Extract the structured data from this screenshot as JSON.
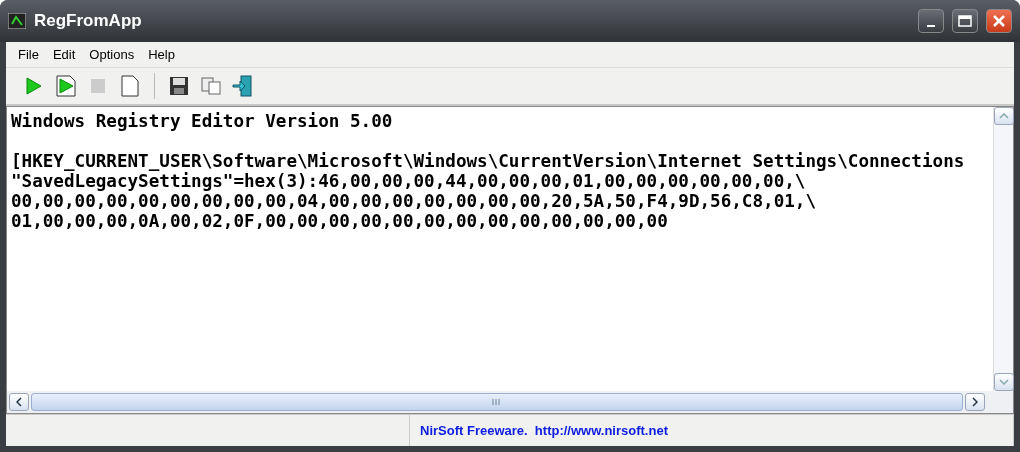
{
  "window": {
    "title": "RegFromApp"
  },
  "menu": [
    "File",
    "Edit",
    "Options",
    "Help"
  ],
  "toolbar": [
    [
      {
        "kind": "play",
        "disabled": false
      },
      {
        "kind": "play-page",
        "disabled": false
      },
      {
        "kind": "stop",
        "disabled": true
      },
      {
        "kind": "new",
        "disabled": false
      }
    ],
    [
      {
        "kind": "save",
        "disabled": false
      },
      {
        "kind": "copy",
        "disabled": false
      },
      {
        "kind": "exit",
        "disabled": false
      }
    ]
  ],
  "editor": {
    "paragraphs": [
      [
        "Windows Registry Editor Version 5.00"
      ],
      [
        "[HKEY_CURRENT_USER\\Software\\Microsoft\\Windows\\CurrentVersion\\Internet Settings\\Connections",
        "\"SavedLegacySettings\"=hex(3):46,00,00,00,44,00,00,00,01,00,00,00,00,00,00,\\",
        "00,00,00,00,00,00,00,00,00,04,00,00,00,00,00,00,00,20,5A,50,F4,9D,56,C8,01,\\",
        "01,00,00,00,0A,00,02,0F,00,00,00,00,00,00,00,00,00,00,00,00,00"
      ]
    ]
  },
  "status_bar": {
    "text": "NirSoft Freeware.  http://www.nirsoft.net"
  }
}
